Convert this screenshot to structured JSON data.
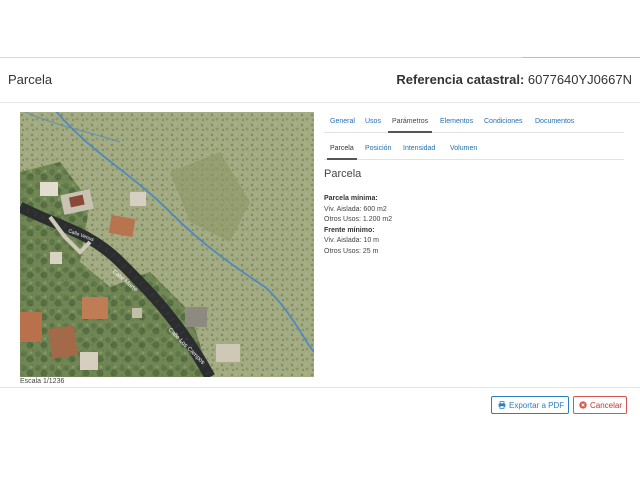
{
  "header": {
    "title": "Parcela",
    "ref_label": "Referencia catastral:",
    "ref_value": "6077640YJ0667N"
  },
  "map": {
    "scale_label": "Escala 1/1236",
    "street_labels": [
      "Calle Marte",
      "Calle Los Campos",
      "Calle Venus"
    ]
  },
  "tabs": {
    "primary": [
      "General",
      "Usos",
      "Parámetros",
      "Elementos",
      "Condiciones",
      "Documentos"
    ],
    "primary_active": "Parámetros",
    "secondary": [
      "Parcela",
      "Posición",
      "Intensidad",
      "Volumen"
    ],
    "secondary_active": "Parcela"
  },
  "section": {
    "title": "Parcela",
    "min_parcel_heading": "Parcela mínima:",
    "min_parcel_viv": "Viv. Aislada: 600 m2",
    "min_parcel_otros": "Otros Usos: 1.200 m2",
    "min_front_heading": "Frente mínimo:",
    "min_front_viv": "Viv. Aislada: 10 m",
    "min_front_otros": "Otros Usos: 25 m"
  },
  "buttons": {
    "export": "Exportar a PDF",
    "cancel": "Cancelar"
  },
  "colors": {
    "accent": "#2a7fc4",
    "danger": "#d9534f",
    "parcel_line": "#4a86c8"
  }
}
